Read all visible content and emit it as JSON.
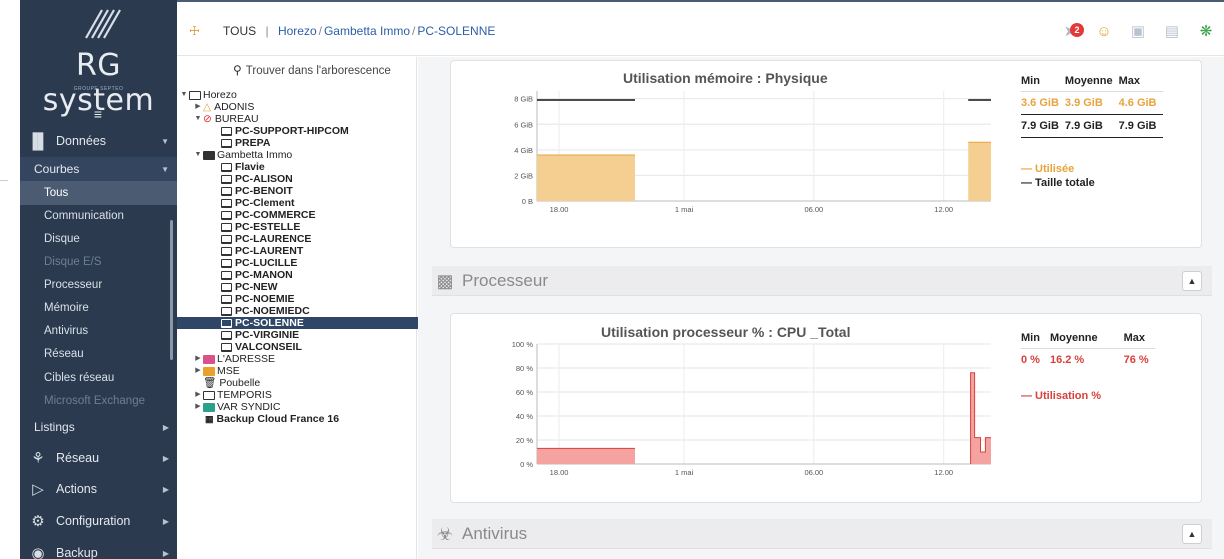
{
  "sidebar": {
    "logo": "RG system",
    "logo_sub": "GROUPE SEPTEO",
    "menu_icon": "hamburger-icon",
    "donnees": "Données",
    "courbes": "Courbes",
    "sub_items": [
      "Tous",
      "Communication",
      "Disque",
      "Disque E/S",
      "Processeur",
      "Mémoire",
      "Antivirus",
      "Réseau",
      "Cibles réseau",
      "Microsoft Exchange"
    ],
    "listings": "Listings",
    "main_items": [
      "Réseau",
      "Actions",
      "Configuration",
      "Backup"
    ]
  },
  "breadcrumb": {
    "root": "TOUS",
    "sep": "|",
    "path": [
      "Horezo",
      "Gambetta Immo",
      "PC-SOLENNE"
    ]
  },
  "topbar": {
    "badge_count": "2"
  },
  "tree": {
    "search_label": "Trouver dans l'arborescence",
    "root": "Horezo",
    "nodes": {
      "adonis": "ADONIS",
      "bureau": "BUREAU",
      "pc_support": "PC-SUPPORT-HIPCOM",
      "prepa": "PREPA",
      "gambetta": "Gambetta Immo",
      "pcs": [
        "Flavie",
        "PC-ALISON",
        "PC-BENOIT",
        "PC-Clement",
        "PC-COMMERCE",
        "PC-ESTELLE",
        "PC-LAURENCE",
        "PC-LAURENT",
        "PC-LUCILLE",
        "PC-MANON",
        "PC-NEW",
        "PC-NOEMIE",
        "PC-NOEMIEDC",
        "PC-SOLENNE",
        "PC-VIRGINIE",
        "VALCONSEIL"
      ],
      "adresse": "L'ADRESSE",
      "mse": "MSE",
      "poubelle": "Poubelle",
      "temporis": "TEMPORIS",
      "var_syndic": "VAR SYNDIC",
      "backup_cloud": "Backup Cloud France 16"
    }
  },
  "memory": {
    "title": "Utilisation mémoire : Physique",
    "stats_headers": [
      "Min",
      "Moyenne",
      "Max"
    ],
    "used_row": [
      "3.6 GiB",
      "3.9 GiB",
      "4.6 GiB"
    ],
    "total_row": [
      "7.9 GiB",
      "7.9 GiB",
      "7.9 GiB"
    ],
    "legend_used": "— Utilisée",
    "legend_total": "— Taille totale",
    "used_color": "#e8a33c",
    "total_color": "#111111"
  },
  "processor": {
    "section_title": "Processeur",
    "title": "Utilisation processeur % : CPU _Total",
    "stats_headers": [
      "Min",
      "Moyenne",
      "Max"
    ],
    "row": [
      "0 %",
      "16.2 %",
      "76 %"
    ],
    "legend": "— Utilisation %",
    "color": "#d8403c"
  },
  "antivirus": {
    "section_title": "Antivirus"
  },
  "chart_data": [
    {
      "type": "area",
      "title": "Utilisation mémoire : Physique",
      "x_ticks": [
        "18.00",
        "1 mai",
        "06.00",
        "12.00"
      ],
      "y_ticks": [
        "0 B",
        "2 GiB",
        "4 GiB",
        "6 GiB",
        "8 GiB"
      ],
      "ylim": [
        0,
        8.6
      ],
      "series": [
        {
          "name": "Utilisée",
          "segments": [
            {
              "x": [
                0,
                0.2
              ],
              "y": [
                3.6,
                3.6
              ]
            },
            {
              "x": [
                0.88,
                0.96,
                0.96,
                1.0
              ],
              "y": [
                4.6,
                4.6,
                4.2,
                4.2
              ]
            }
          ]
        },
        {
          "name": "Taille totale",
          "segments": [
            {
              "x": [
                0,
                0.2
              ],
              "y": [
                7.9,
                7.9
              ]
            },
            {
              "x": [
                0.88,
                1.0
              ],
              "y": [
                7.9,
                7.9
              ]
            }
          ]
        }
      ]
    },
    {
      "type": "area",
      "title": "Utilisation processeur % : CPU _Total",
      "x_ticks": [
        "18.00",
        "1 mai",
        "06.00",
        "12.00"
      ],
      "y_ticks": [
        "0 %",
        "20 %",
        "40 %",
        "60 %",
        "80 %",
        "100 %"
      ],
      "ylim": [
        0,
        100
      ],
      "series": [
        {
          "name": "Utilisation %",
          "segments": [
            {
              "x": [
                0,
                0.2
              ],
              "y": [
                13,
                13
              ]
            },
            {
              "x": [
                0.885,
                0.885,
                0.893,
                0.893,
                0.905,
                0.905,
                0.915,
                0.915,
                0.94,
                0.94,
                0.975,
                0.975,
                1.0
              ],
              "y": [
                0,
                76,
                76,
                22,
                22,
                10,
                10,
                22,
                22,
                23,
                23,
                20,
                20
              ]
            }
          ]
        }
      ]
    }
  ]
}
